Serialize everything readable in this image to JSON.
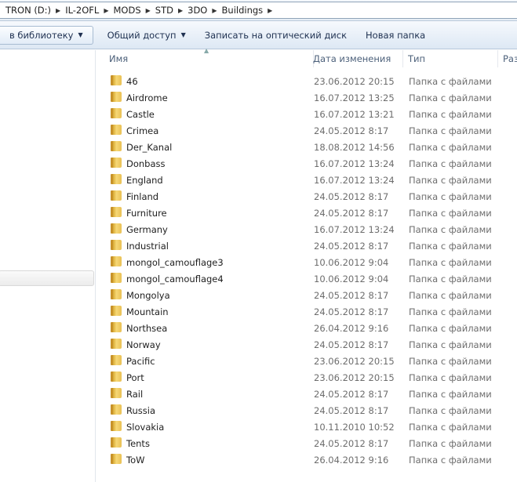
{
  "breadcrumb": [
    "TRON (D:)",
    "IL-2OFL",
    "MODS",
    "STD",
    "3DO",
    "Buildings"
  ],
  "toolbar": {
    "library": "в библиотеку",
    "share": "Общий доступ",
    "burn": "Записать на оптический диск",
    "new_folder": "Новая папка"
  },
  "columns": {
    "name": "Имя",
    "date": "Дата изменения",
    "type": "Тип",
    "size": "Раз"
  },
  "files": [
    {
      "name": "46",
      "date": "23.06.2012 20:15",
      "type": "Папка с файлами"
    },
    {
      "name": "Airdrome",
      "date": "16.07.2012 13:25",
      "type": "Папка с файлами"
    },
    {
      "name": "Castle",
      "date": "16.07.2012 13:21",
      "type": "Папка с файлами"
    },
    {
      "name": "Crimea",
      "date": "24.05.2012 8:17",
      "type": "Папка с файлами"
    },
    {
      "name": "Der_Kanal",
      "date": "18.08.2012 14:56",
      "type": "Папка с файлами"
    },
    {
      "name": "Donbass",
      "date": "16.07.2012 13:24",
      "type": "Папка с файлами"
    },
    {
      "name": "England",
      "date": "16.07.2012 13:24",
      "type": "Папка с файлами"
    },
    {
      "name": "Finland",
      "date": "24.05.2012 8:17",
      "type": "Папка с файлами"
    },
    {
      "name": "Furniture",
      "date": "24.05.2012 8:17",
      "type": "Папка с файлами"
    },
    {
      "name": "Germany",
      "date": "16.07.2012 13:24",
      "type": "Папка с файлами"
    },
    {
      "name": "Industrial",
      "date": "24.05.2012 8:17",
      "type": "Папка с файлами"
    },
    {
      "name": "mongol_camouflage3",
      "date": "10.06.2012 9:04",
      "type": "Папка с файлами"
    },
    {
      "name": "mongol_camouflage4",
      "date": "10.06.2012 9:04",
      "type": "Папка с файлами"
    },
    {
      "name": "Mongolya",
      "date": "24.05.2012 8:17",
      "type": "Папка с файлами"
    },
    {
      "name": "Mountain",
      "date": "24.05.2012 8:17",
      "type": "Папка с файлами"
    },
    {
      "name": "Northsea",
      "date": "26.04.2012 9:16",
      "type": "Папка с файлами"
    },
    {
      "name": "Norway",
      "date": "24.05.2012 8:17",
      "type": "Папка с файлами"
    },
    {
      "name": "Pacific",
      "date": "23.06.2012 20:15",
      "type": "Папка с файлами"
    },
    {
      "name": "Port",
      "date": "23.06.2012 20:15",
      "type": "Папка с файлами"
    },
    {
      "name": "Rail",
      "date": "24.05.2012 8:17",
      "type": "Папка с файлами"
    },
    {
      "name": "Russia",
      "date": "24.05.2012 8:17",
      "type": "Папка с файлами"
    },
    {
      "name": "Slovakia",
      "date": "10.11.2010 10:52",
      "type": "Папка с файлами"
    },
    {
      "name": "Tents",
      "date": "24.05.2012 8:17",
      "type": "Папка с файлами"
    },
    {
      "name": "ToW",
      "date": "26.04.2012 9:16",
      "type": "Папка с файлами"
    }
  ]
}
